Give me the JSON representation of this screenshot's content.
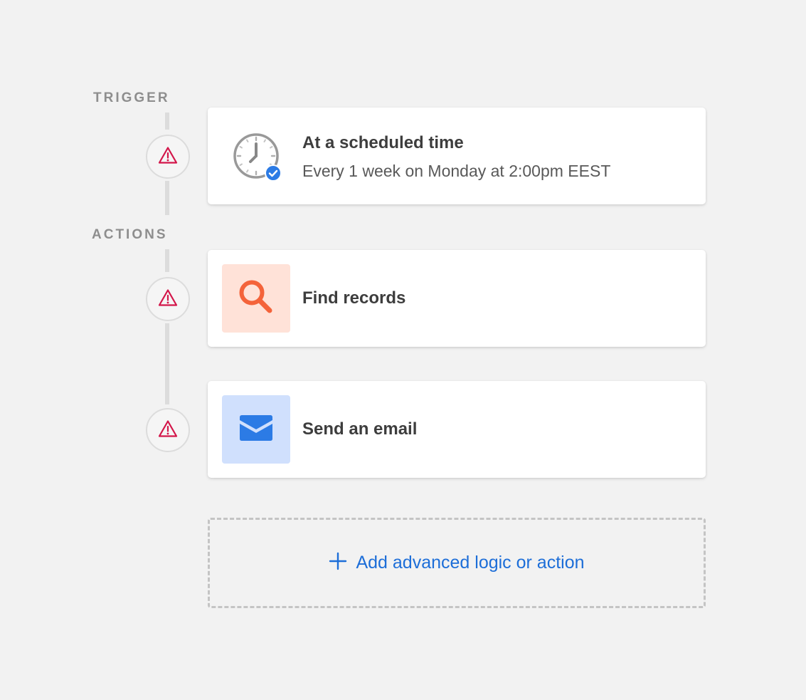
{
  "sections": {
    "trigger_label": "TRIGGER",
    "actions_label": "ACTIONS"
  },
  "trigger": {
    "title": "At a scheduled time",
    "subtitle": "Every 1 week on Monday at 2:00pm EEST",
    "icon": "clock-icon",
    "badge_icon": "check-badge-icon",
    "status_icon": "warning-icon"
  },
  "actions": [
    {
      "title": "Find records",
      "icon": "search-icon",
      "tile_color": "#ffe2d8",
      "icon_color": "#f4633a",
      "status_icon": "warning-icon"
    },
    {
      "title": "Send an email",
      "icon": "envelope-icon",
      "tile_color": "#d0e0fd",
      "icon_color": "#2c7be5",
      "status_icon": "warning-icon"
    }
  ],
  "add_step": {
    "label": "Add advanced logic or action",
    "icon": "plus-icon"
  },
  "colors": {
    "background": "#f2f2f2",
    "warning": "#d3164a",
    "link": "#1d6ed8",
    "check_badge": "#2c7be5"
  }
}
